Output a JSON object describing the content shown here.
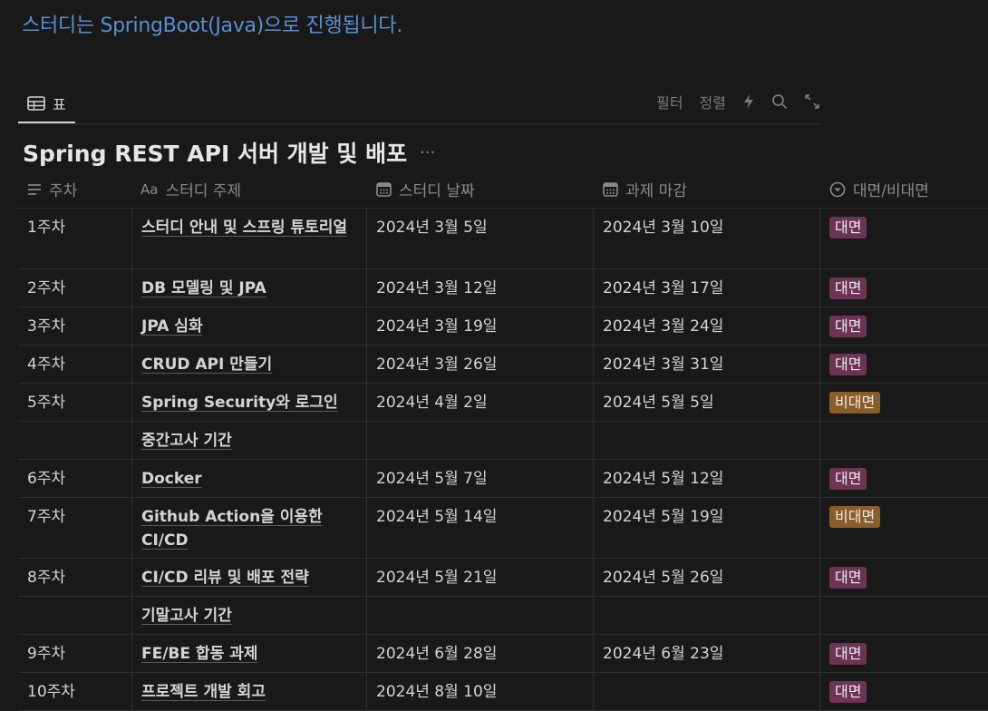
{
  "banner": "스터디는 SpringBoot(Java)으로 진행됩니다.",
  "view_tab": {
    "label": "표"
  },
  "toolbar": {
    "filter": "필터",
    "sort": "정렬"
  },
  "db_title": "Spring REST API 서버 개발 및 배포",
  "db_more": "···",
  "columns": {
    "week": "주차",
    "topic": "스터디 주제",
    "topic_prefix": "Aa",
    "date": "스터디 날짜",
    "due": "과제 마감",
    "mode": "대면/비대면"
  },
  "badge_colors": {
    "대면": "#6c3452",
    "비대면": "#8a5e2a"
  },
  "rows": [
    {
      "week": "1주차",
      "topic": "스터디 안내 및 스프링 튜토리얼",
      "date": "2024년 3월 5일",
      "due": "2024년 3월 10일",
      "mode": "대면"
    },
    {
      "week": "2주차",
      "topic": "DB 모델링 및 JPA",
      "date": "2024년 3월 12일",
      "due": "2024년 3월 17일",
      "mode": "대면"
    },
    {
      "week": "3주차",
      "topic": "JPA 심화",
      "date": "2024년 3월 19일",
      "due": "2024년 3월 24일",
      "mode": "대면"
    },
    {
      "week": "4주차",
      "topic": "CRUD API 만들기",
      "date": "2024년 3월 26일",
      "due": "2024년 3월 31일",
      "mode": "대면"
    },
    {
      "week": "5주차",
      "topic": "Spring Security와 로그인",
      "date": "2024년 4월 2일",
      "due": "2024년 5월 5일",
      "mode": "비대면"
    },
    {
      "week": "",
      "topic": "중간고사 기간",
      "date": "",
      "due": "",
      "mode": ""
    },
    {
      "week": "6주차",
      "topic": "Docker",
      "date": "2024년 5월 7일",
      "due": "2024년 5월 12일",
      "mode": "대면"
    },
    {
      "week": "7주차",
      "topic": "Github Action을 이용한 CI/CD",
      "date": "2024년 5월 14일",
      "due": "2024년 5월 19일",
      "mode": "비대면"
    },
    {
      "week": "8주차",
      "topic": "CI/CD 리뷰 및 배포 전략",
      "date": "2024년 5월 21일",
      "due": "2024년 5월 26일",
      "mode": "대면"
    },
    {
      "week": "",
      "topic": "기말고사 기간",
      "date": "",
      "due": "",
      "mode": ""
    },
    {
      "week": "9주차",
      "topic": "FE/BE 합동 과제",
      "date": "2024년 6월 28일",
      "due": "2024년 6월 23일",
      "mode": "대면"
    },
    {
      "week": "10주차",
      "topic": "프로젝트 개발 회고",
      "date": "2024년 8월 10일",
      "due": "",
      "mode": "대면"
    }
  ]
}
